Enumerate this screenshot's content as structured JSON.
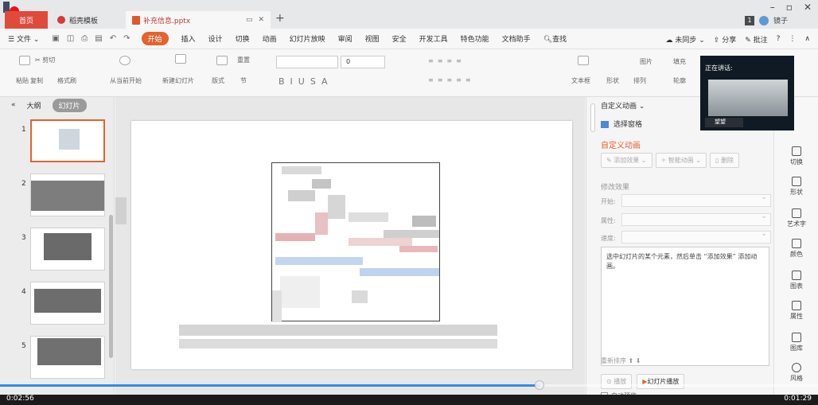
{
  "tabs": {
    "home": "首页",
    "template": "稻壳模板",
    "file": "补充信息.pptx",
    "new": "+"
  },
  "user": {
    "name": "镜子",
    "badge": "1"
  },
  "menu": {
    "file": "文件",
    "items": [
      "开始",
      "插入",
      "设计",
      "切换",
      "动画",
      "幻灯片放映",
      "审阅",
      "视图",
      "安全",
      "开发工具",
      "特色功能",
      "文档助手"
    ],
    "search": "查找",
    "sync": "未同步",
    "share": "分享",
    "comment": "批注",
    "help": "?"
  },
  "ribbon": {
    "paste": "粘贴",
    "cut": "剪切",
    "copy": "复制",
    "format_painter": "格式刷",
    "from_current": "从当前开始",
    "new_slide": "新建幻灯片",
    "layout": "版式",
    "section": "节",
    "reset": "重置",
    "font_size": "0",
    "textbox": "文本框",
    "shape": "形状",
    "arrange": "排列",
    "picture": "图片",
    "fill": "填充",
    "outline": "轮廓"
  },
  "left_panel": {
    "outline_tab": "大纲",
    "slides_tab": "幻灯片",
    "slide_numbers": [
      "1",
      "2",
      "3",
      "4",
      "5"
    ]
  },
  "task_pane": {
    "title": "自定义动画",
    "select_pane": "选择窗格",
    "section_title": "自定义动画",
    "add_effect": "添加效果",
    "smart_anim": "智能动画",
    "delete": "删除",
    "modify": "修改效果",
    "start_label": "开始:",
    "property_label": "属性:",
    "speed_label": "速度:",
    "hint": "选中幻灯片的某个元素，然后单击 “添加效果” 添加动画。",
    "reorder": "重新排序",
    "play": "播放",
    "slideshow": "幻灯片播放",
    "auto_preview": "自动预览"
  },
  "side_tools": [
    "切换",
    "形状",
    "艺术字",
    "颜色",
    "图表",
    "属性",
    "图库",
    "风格"
  ],
  "video": {
    "speaking": "正在讲话:",
    "name": "望望"
  },
  "player": {
    "elapsed": "0:02:56",
    "remaining": "0:01:29",
    "progress": 0.66
  },
  "colors": {
    "accent": "#e2632f",
    "home_tab": "#e04a3a",
    "record": "#e8131b",
    "progress": "#2d8cf0"
  }
}
